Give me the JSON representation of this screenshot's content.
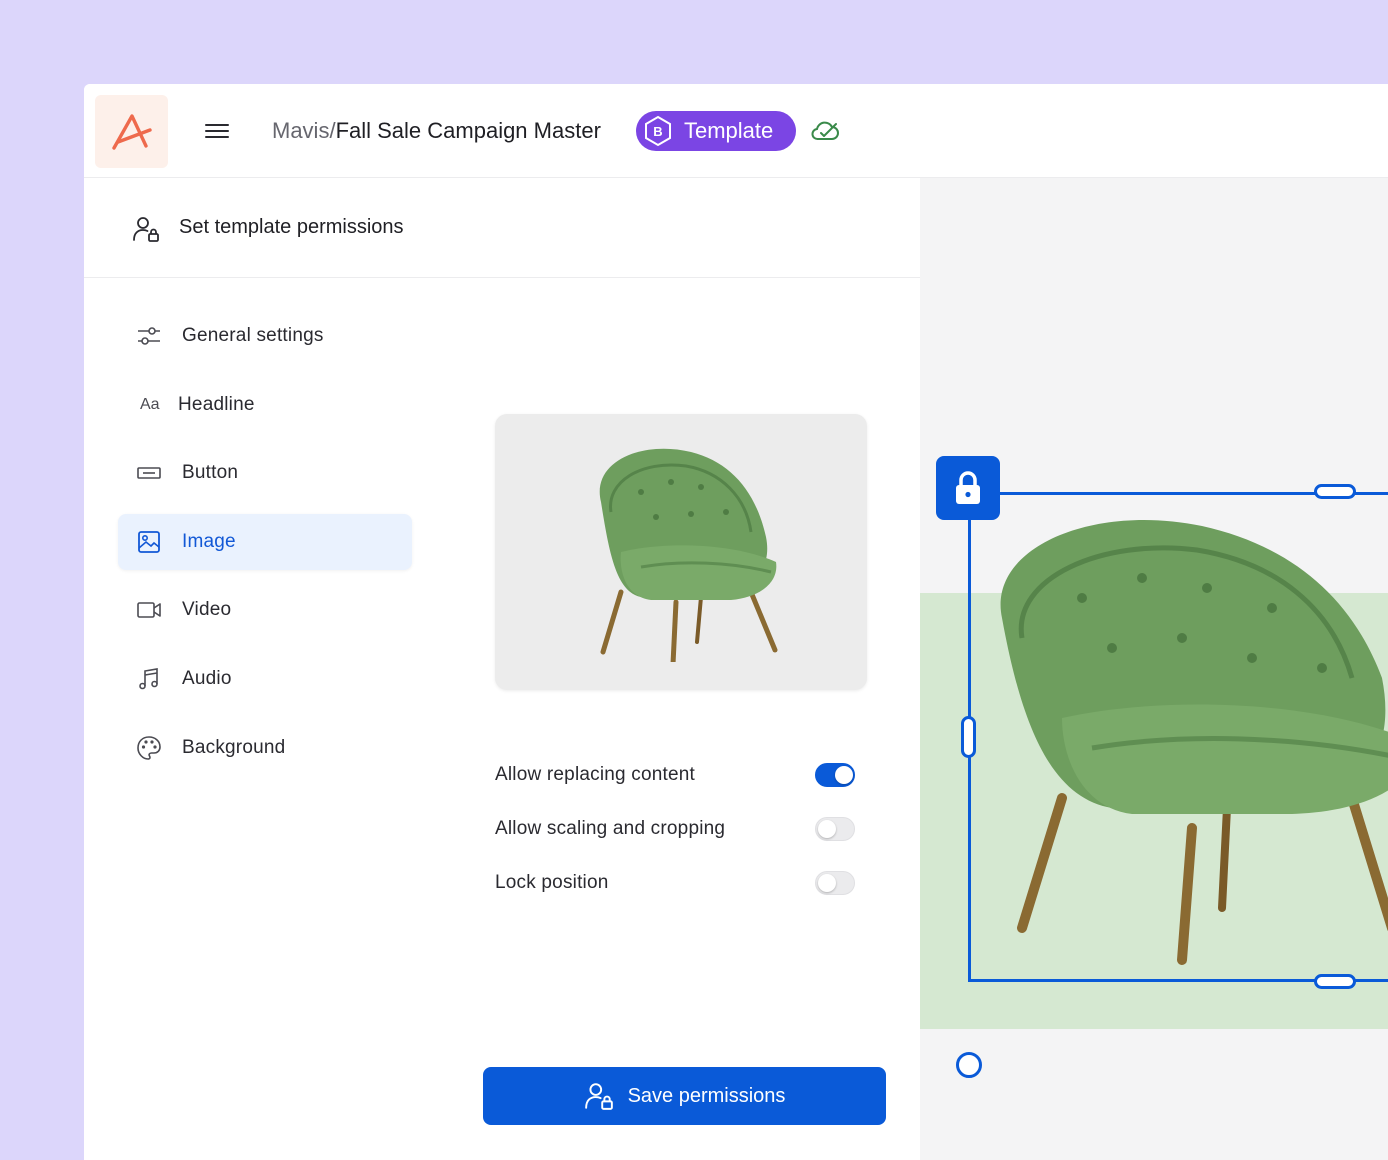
{
  "header": {
    "org": "Mavis/",
    "document_title": "Fall Sale Campaign Master",
    "badge_label": "Template",
    "badge_icon": "hexagon-b-icon",
    "sync_icon": "cloud-check-icon"
  },
  "panel": {
    "title": "Set template permissions",
    "nav_items": [
      {
        "label": "General settings",
        "icon": "sliders-icon"
      },
      {
        "label": "Headline",
        "icon": "Aa"
      },
      {
        "label": "Button",
        "icon": "button-icon"
      },
      {
        "label": "Image",
        "icon": "image-icon",
        "active": true
      },
      {
        "label": "Video",
        "icon": "video-icon"
      },
      {
        "label": "Audio",
        "icon": "music-icon"
      },
      {
        "label": "Background",
        "icon": "palette-icon"
      }
    ],
    "options": [
      {
        "label": "Allow replacing content",
        "enabled": true
      },
      {
        "label": "Allow scaling and cropping",
        "enabled": false
      },
      {
        "label": "Lock position",
        "enabled": false
      }
    ],
    "save_label": "Save permissions"
  },
  "colors": {
    "accent": "#0a5ad8",
    "badge": "#7b45e4",
    "logo": "#ee6a4d",
    "backdrop": "#dcd6fb",
    "canvas_green": "#d5e8d1"
  }
}
